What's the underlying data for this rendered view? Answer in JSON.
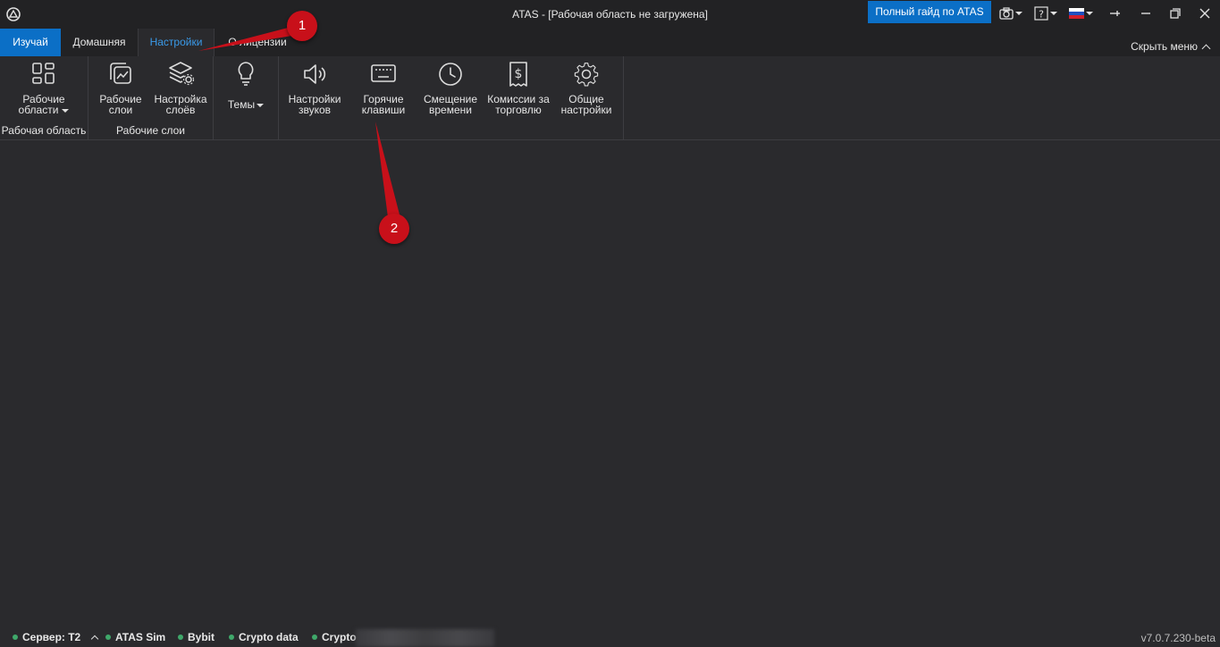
{
  "titlebar": {
    "title": "ATAS - [Рабочая область не загружена]",
    "guide_button": "Полный гайд по ATAS"
  },
  "tabs": [
    {
      "label": "Изучай"
    },
    {
      "label": "Домашняя"
    },
    {
      "label": "Настройки",
      "active": true
    },
    {
      "label": "О лицензии"
    }
  ],
  "hide_menu": "Скрыть меню",
  "ribbon": {
    "workspace_group": {
      "label": "Рабочая область",
      "button": {
        "line1": "Рабочие",
        "line2": "области",
        "icon": "workspaces-icon"
      }
    },
    "layers_group": {
      "label": "Рабочие слои",
      "buttons": [
        {
          "line1": "Рабочие",
          "line2": "слои",
          "icon": "layers-chart-icon"
        },
        {
          "line1": "Настройка",
          "line2": "слоёв",
          "icon": "layers-settings-icon"
        }
      ]
    },
    "themes": {
      "label": "Темы",
      "icon": "lightbulb-icon"
    },
    "settings_buttons": [
      {
        "line1": "Настройки",
        "line2": "звуков",
        "icon": "speaker-icon"
      },
      {
        "line1": "Горячие",
        "line2": "клавиши",
        "icon": "keyboard-icon"
      },
      {
        "line1": "Смещение",
        "line2": "времени",
        "icon": "clock-icon"
      },
      {
        "line1": "Комиссии за",
        "line2": "торговлю",
        "icon": "receipt-dollar-icon"
      },
      {
        "line1": "Общие",
        "line2": "настройки",
        "icon": "gear-icon"
      }
    ]
  },
  "annotations": [
    {
      "number": "1"
    },
    {
      "number": "2"
    }
  ],
  "statusbar": {
    "server": "Сервер: T2",
    "connections": [
      "ATAS Sim",
      "Bybit",
      "Crypto data",
      "Crypto"
    ],
    "version": "v7.0.7.230-beta"
  },
  "colors": {
    "accent": "#0b6fc6",
    "active_tab_text": "#3a9ae8",
    "connection_dot": "#3fa86a",
    "annotation": "#c8101a",
    "background": "#2a2a2d"
  }
}
